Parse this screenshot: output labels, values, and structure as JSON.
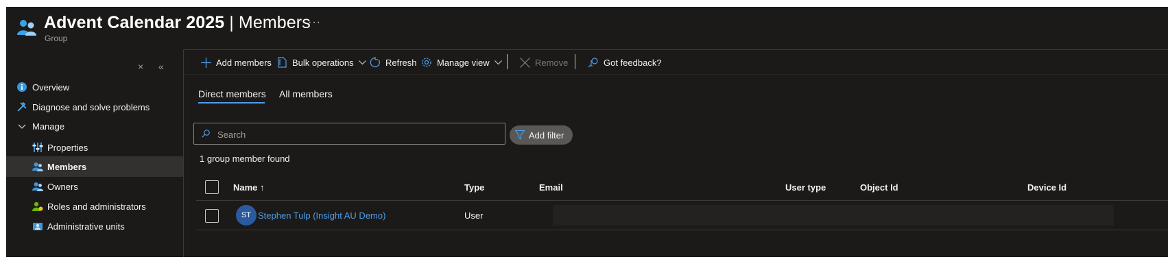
{
  "header": {
    "title_bold": "Advent Calendar 2025",
    "title_rest": " | Members",
    "subtitle": "Group",
    "more_label": "···"
  },
  "sidebar": {
    "close_glyph": "×",
    "collapse_glyph": "«",
    "items": [
      {
        "label": "Overview",
        "icon": "info-icon"
      },
      {
        "label": "Diagnose and solve problems",
        "icon": "wrench-icon"
      },
      {
        "label": "Manage",
        "icon": "chevron-down-icon"
      },
      {
        "label": "Properties",
        "icon": "properties-icon"
      },
      {
        "label": "Members",
        "icon": "members-icon",
        "selected": true
      },
      {
        "label": "Owners",
        "icon": "owners-icon"
      },
      {
        "label": "Roles and administrators",
        "icon": "roles-icon"
      },
      {
        "label": "Administrative units",
        "icon": "admin-units-icon"
      }
    ]
  },
  "toolbar": {
    "add_members": "Add members",
    "bulk_operations": "Bulk operations",
    "refresh": "Refresh",
    "manage_view": "Manage view",
    "remove": "Remove",
    "feedback": "Got feedback?"
  },
  "tabs": {
    "direct": "Direct members",
    "all": "All members"
  },
  "search": {
    "placeholder": "Search"
  },
  "filter": {
    "label": "Add filter"
  },
  "result_count": "1 group member found",
  "table": {
    "columns": {
      "name": "Name ↑",
      "type": "Type",
      "email": "Email",
      "user_type": "User type",
      "object_id": "Object Id",
      "device_id": "Device Id"
    },
    "rows": [
      {
        "initials": "ST",
        "name": "Stephen Tulp (Insight AU Demo)",
        "type": "User"
      }
    ]
  },
  "colors": {
    "background": "#1b1a19",
    "accent": "#4f9ee8",
    "selected": "#323130",
    "avatar": "#2b5b9e"
  }
}
